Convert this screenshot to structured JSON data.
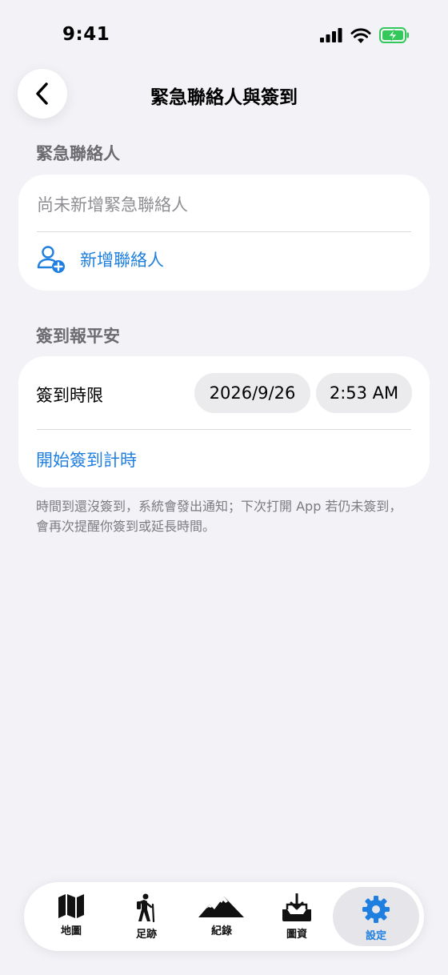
{
  "status_bar": {
    "time": "9:41"
  },
  "nav": {
    "title": "緊急聯絡人與簽到"
  },
  "emergency_contacts": {
    "header": "緊急聯絡人",
    "empty_text": "尚未新增緊急聯絡人",
    "add_label": "新增聯絡人"
  },
  "checkin": {
    "header": "簽到報平安",
    "deadline_label": "簽到時限",
    "date": "2026/9/26",
    "time": "2:53 AM",
    "start_label": "開始簽到計時",
    "footnote": "時間到還沒簽到，系統會發出通知；下次打開 App 若仍未簽到，會再次提醒你簽到或延長時間。"
  },
  "tabs": [
    {
      "label": "地圖",
      "icon": "map-icon"
    },
    {
      "label": "足跡",
      "icon": "hiker-icon"
    },
    {
      "label": "紀錄",
      "icon": "mountains-icon"
    },
    {
      "label": "圖資",
      "icon": "download-tray-icon"
    },
    {
      "label": "設定",
      "icon": "gear-icon",
      "active": true
    }
  ],
  "colors": {
    "accent": "#1e7fe0",
    "background": "#f2f2f7",
    "battery": "#34c759"
  }
}
